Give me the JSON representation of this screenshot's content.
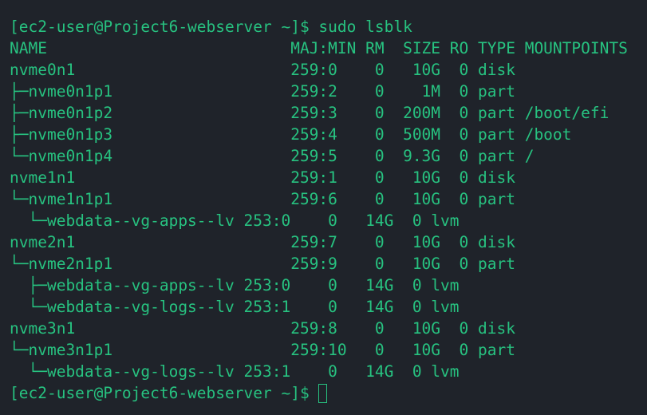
{
  "terminal": {
    "command_line": "[ec2-user@Project6-webserver ~]$ sudo lsblk",
    "header": "NAME                          MAJ:MIN RM  SIZE RO TYPE MOUNTPOINTS",
    "rows": [
      "nvme0n1                       259:0    0   10G  0 disk",
      "├─nvme0n1p1                   259:2    0    1M  0 part",
      "├─nvme0n1p2                   259:3    0  200M  0 part /boot/efi",
      "├─nvme0n1p3                   259:4    0  500M  0 part /boot",
      "└─nvme0n1p4                   259:5    0  9.3G  0 part /",
      "nvme1n1                       259:1    0   10G  0 disk",
      "└─nvme1n1p1                   259:6    0   10G  0 part",
      "  └─webdata--vg-apps--lv 253:0    0   14G  0 lvm",
      "nvme2n1                       259:7    0   10G  0 disk",
      "└─nvme2n1p1                   259:9    0   10G  0 part",
      "  ├─webdata--vg-apps--lv 253:0    0   14G  0 lvm",
      "  └─webdata--vg-logs--lv 253:1    0   14G  0 lvm",
      "nvme3n1                       259:8    0   10G  0 disk",
      "└─nvme3n1p1                   259:10   0   10G  0 part",
      "  └─webdata--vg-logs--lv 253:1    0   14G  0 lvm"
    ],
    "prompt": "[ec2-user@Project6-webserver ~]$ "
  }
}
